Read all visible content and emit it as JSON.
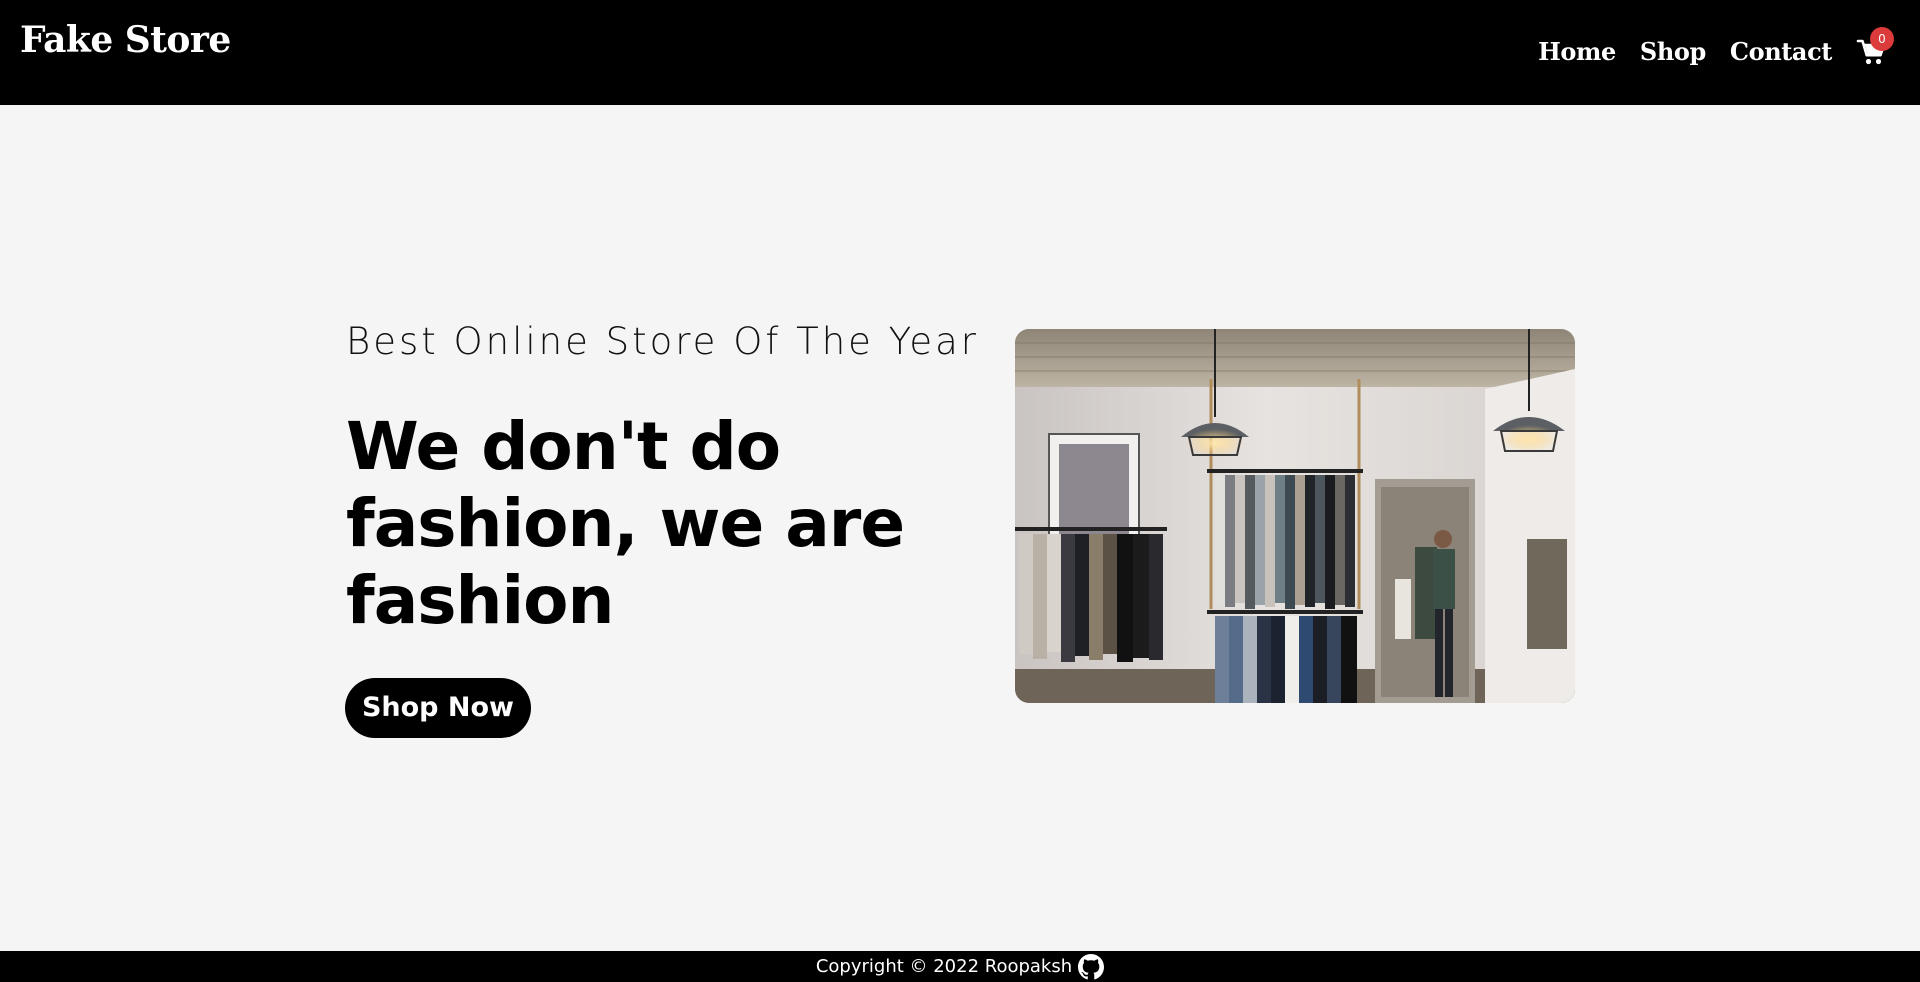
{
  "navbar": {
    "brand": "Fake Store",
    "links": [
      "Home",
      "Shop",
      "Contact"
    ],
    "cart_icon": "cart-icon",
    "cart_count": "0",
    "badge_color": "#dc3b3b"
  },
  "hero": {
    "tagline": "Best Online Store Of The Year",
    "headline": "We don't do fashion, we are fashion",
    "cta_label": "Shop Now",
    "image_subject": "clothing store interior with racks of shirts and pendant lamps"
  },
  "footer": {
    "copyright": "Copyright © 2022 Roopaksh",
    "icon": "github-icon"
  },
  "colors": {
    "nav_background": "#000000",
    "page_background": "#f5f5f5",
    "button_background": "#000000"
  }
}
